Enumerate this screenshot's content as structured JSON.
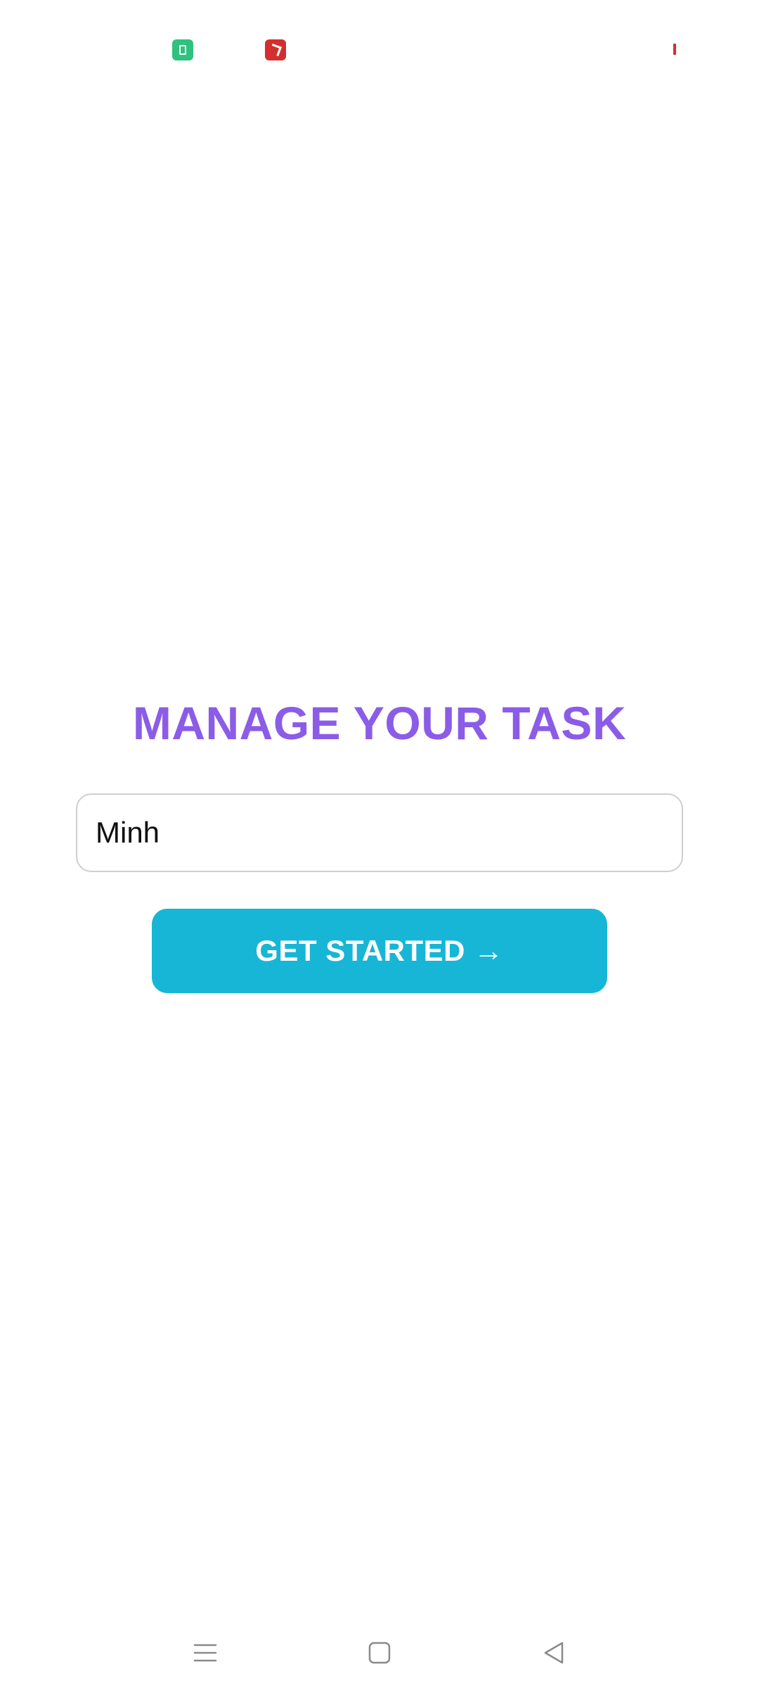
{
  "status_bar": {
    "icons": [
      "app-notification-icon",
      "game-app-icon",
      "battery-low-indicator"
    ]
  },
  "main": {
    "title": "MANAGE YOUR TASK",
    "name_input": {
      "value": "Minh",
      "placeholder": ""
    },
    "cta_label": "GET STARTED →"
  },
  "nav_bar": {
    "buttons": [
      "menu-icon",
      "home-icon",
      "back-icon"
    ]
  },
  "colors": {
    "title": "#8b5ce8",
    "button": "#17b6d6",
    "input_border": "#cfcfcf"
  }
}
